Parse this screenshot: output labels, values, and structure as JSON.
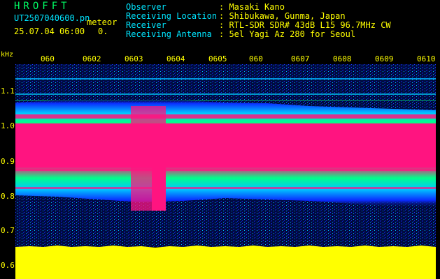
{
  "header": {
    "logo": "HROFFT",
    "filename": "UT2507040600.pn",
    "tag": "meteor",
    "datetime": "25.07.04 06:00",
    "count": "0.",
    "fields": [
      {
        "label": "Observer",
        "value": ": Masaki Kano"
      },
      {
        "label": "Receiving Location",
        "value": ": Shibukawa, Gunma, Japan"
      },
      {
        "label": "Receiver",
        "value": ": RTL-SDR SDR# 43dB L15 96.7MHz CW"
      },
      {
        "label": "Receiving Antenna",
        "value": ": 5el Yagi Az 280 for Seoul"
      }
    ]
  },
  "axes": {
    "unit": "kHz",
    "y_ticks": [
      "1.1",
      "1.0",
      "0.9",
      "0.8",
      "0.7",
      "0.6"
    ],
    "x_ticks": [
      "060",
      "0602",
      "0603",
      "0604",
      "0605",
      "060",
      "0607",
      "0608",
      "0609",
      "0610"
    ]
  },
  "colors": {
    "background": "#000000",
    "header_label": "#00e5ff",
    "header_value": "#ffff00",
    "logo": "#00ff66",
    "tick": "#ffff00",
    "band": "#ff1480",
    "floor": "#ffff00"
  }
}
